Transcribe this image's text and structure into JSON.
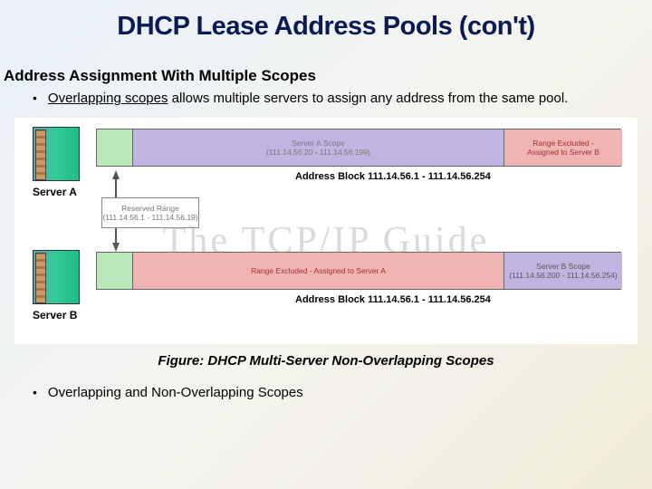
{
  "title": "DHCP Lease Address Pools (con't)",
  "subtitle": "Address Assignment With Multiple Scopes",
  "bullet1_underlined": "Overlapping scopes",
  "bullet1_rest": " allows multiple servers to assign any address from the same pool.",
  "bullet2": "Overlapping and Non-Overlapping Scopes",
  "figure_caption": "Figure:  DHCP Multi-Server Non-Overlapping Scopes",
  "diagram": {
    "server_a_label": "Server A",
    "server_b_label": "Server B",
    "block_a": "Address Block 111.14.56.1 - 111.14.56.254",
    "block_b": "Address Block 111.14.56.1 - 111.14.56.254",
    "reserved_title": "Reserved Range",
    "reserved_range": "(111.14.56.1 - 111.14.56.19)",
    "scope_a_title": "Server A Scope",
    "scope_a_range": "(111.14.56.20 - 111.14.56.199)",
    "excl_a_title": "Range Excluded -",
    "excl_a_sub": "Assigned to Server B",
    "excl_b_text": "Range Excluded - Assigned to Server A",
    "scope_b_title": "Server B Scope",
    "scope_b_range": "(111.14.56.200 - 111.14.56.254)",
    "watermark": "The TCP/IP Guide"
  }
}
